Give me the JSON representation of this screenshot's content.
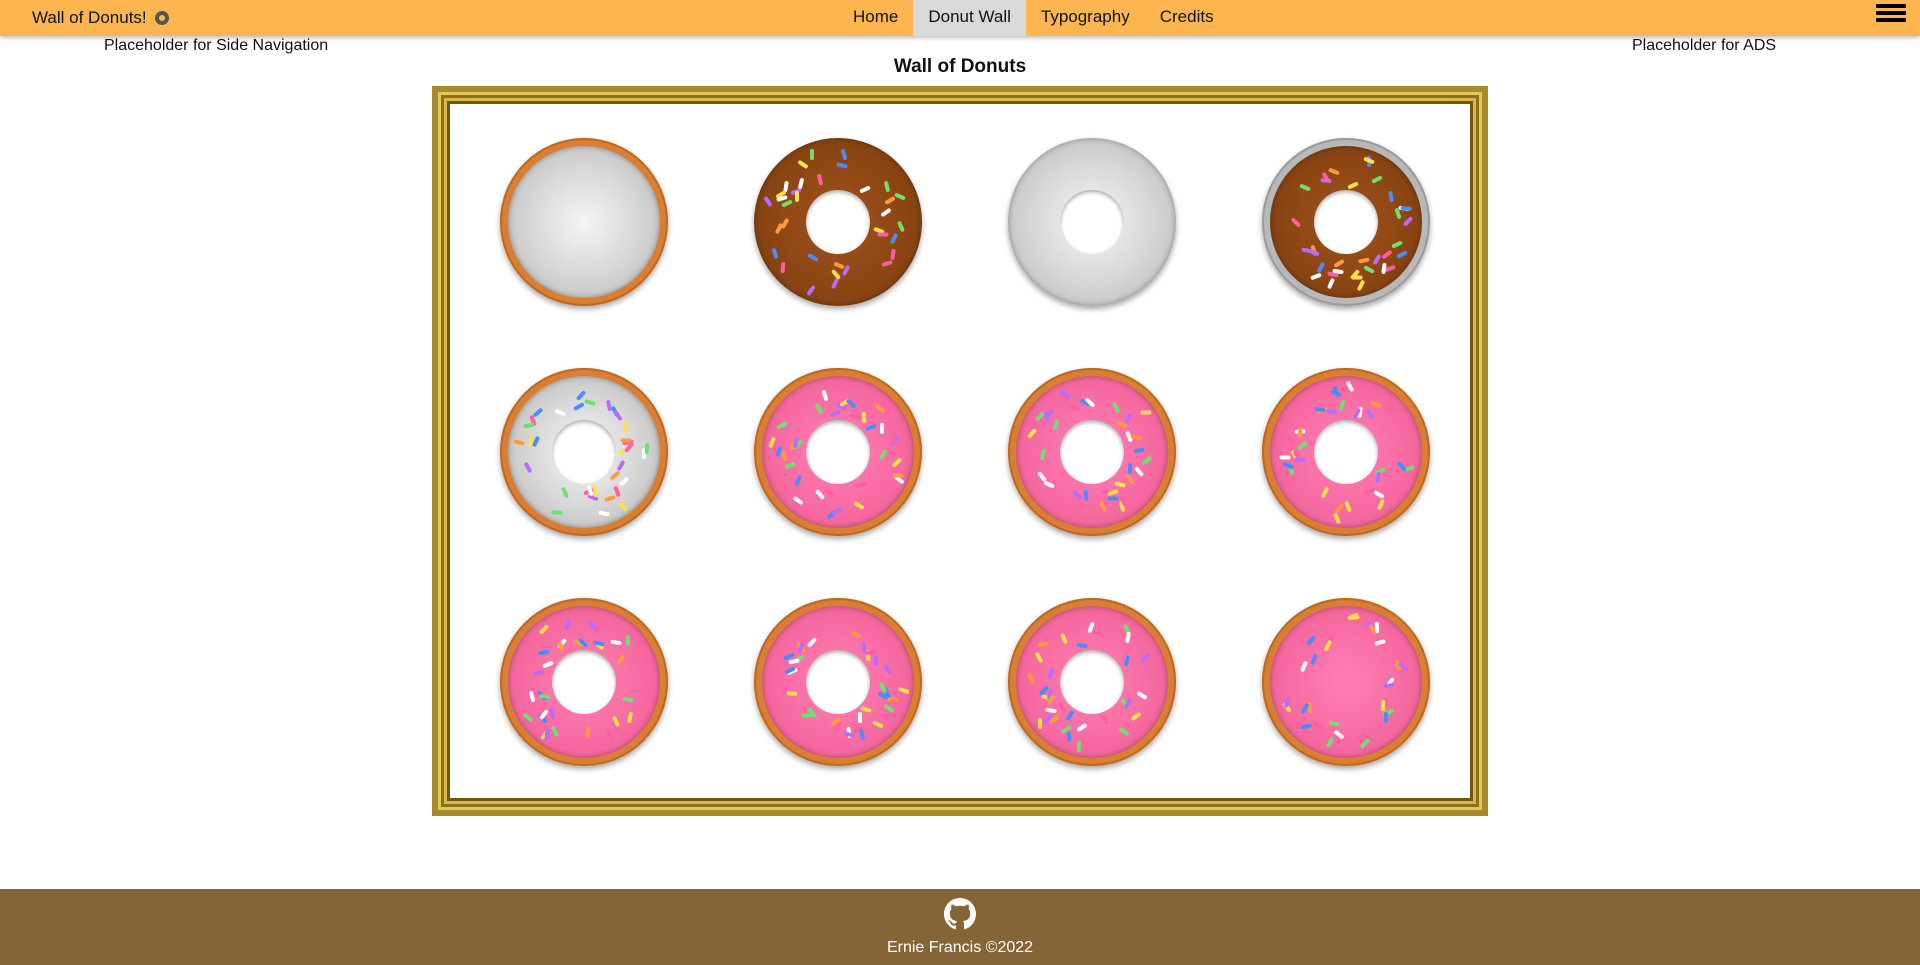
{
  "header": {
    "brand": "Wall of Donuts!",
    "brand_icon": "donut-icon",
    "nav": [
      {
        "label": "Home",
        "active": false
      },
      {
        "label": "Donut Wall",
        "active": true
      },
      {
        "label": "Typography",
        "active": false
      },
      {
        "label": "Credits",
        "active": false
      }
    ],
    "menu_icon": "hamburger-menu-icon"
  },
  "side_nav_placeholder": "Placeholder for Side Navigation",
  "ads_placeholder": "Placeholder for ADS",
  "page_title": "Wall of Donuts",
  "donuts": [
    {
      "ring": true,
      "icing": "silver",
      "hole": false,
      "sprinkles": false
    },
    {
      "ring": false,
      "icing": "choc",
      "hole": true,
      "sprinkles": true
    },
    {
      "ring": false,
      "icing": "silver",
      "hole": true,
      "sprinkles": false
    },
    {
      "ring": "silver",
      "icing": "choc",
      "hole": true,
      "sprinkles": true
    },
    {
      "ring": true,
      "icing": "silver",
      "hole": true,
      "sprinkles": true
    },
    {
      "ring": true,
      "icing": "pink",
      "hole": true,
      "sprinkles": true
    },
    {
      "ring": true,
      "icing": "pink",
      "hole": true,
      "sprinkles": true
    },
    {
      "ring": true,
      "icing": "pink",
      "hole": true,
      "sprinkles": true
    },
    {
      "ring": true,
      "icing": "pink",
      "hole": true,
      "sprinkles": true
    },
    {
      "ring": true,
      "icing": "pink",
      "hole": true,
      "sprinkles": true
    },
    {
      "ring": true,
      "icing": "pink",
      "hole": true,
      "sprinkles": true
    },
    {
      "ring": true,
      "icing": "pink",
      "hole": false,
      "sprinkles": true
    }
  ],
  "colors": {
    "header_bg": "#fdb64f",
    "footer_bg": "#856537",
    "frame_gold": "#a8892c",
    "dough": "#d97f33",
    "pink_icing": "#f4669d",
    "chocolate_icing": "#8b4513"
  },
  "sprinkle_colors": [
    "#ffffff",
    "#ff5fa2",
    "#ffe14d",
    "#6fe06f",
    "#4a8cff",
    "#b86bff",
    "#ff9b3d"
  ],
  "footer": {
    "icon": "github-icon",
    "text": "Ernie Francis ©2022"
  }
}
